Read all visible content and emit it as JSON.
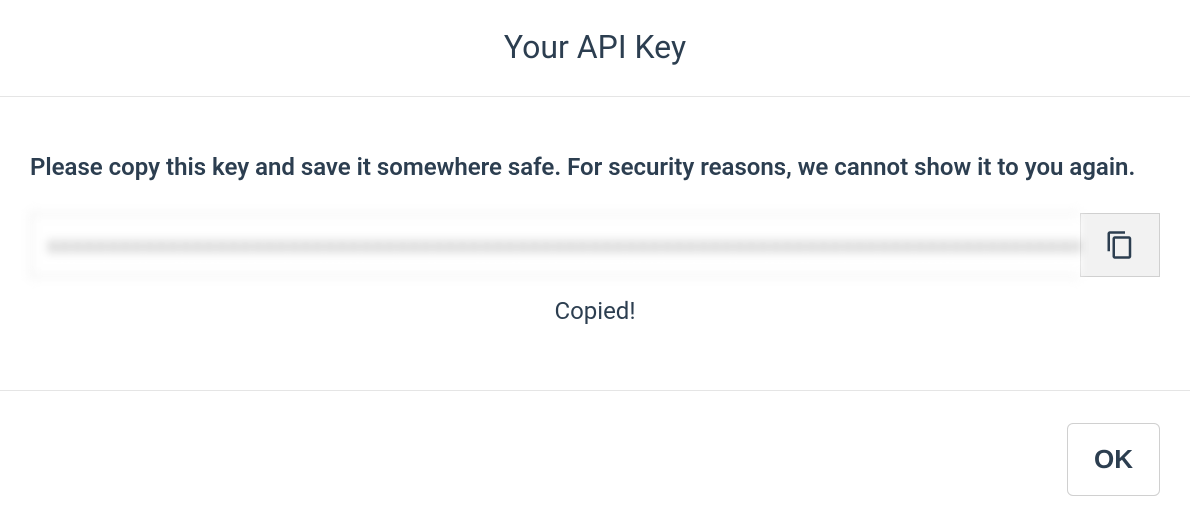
{
  "modal": {
    "title": "Your API Key",
    "instruction": "Please copy this key and save it somewhere safe. For security reasons, we cannot show it to you again.",
    "api_key_masked": "xxxxxxxxxxxxxxxxxxxxxxxxxxxxxxxxxxxxxxxxxxxxxxxxxxxxxxxxxxxxxxxxxxxxxxxxxxxxxxxxxxxxxxxxxx",
    "copied_status": "Copied!",
    "ok_label": "OK"
  }
}
